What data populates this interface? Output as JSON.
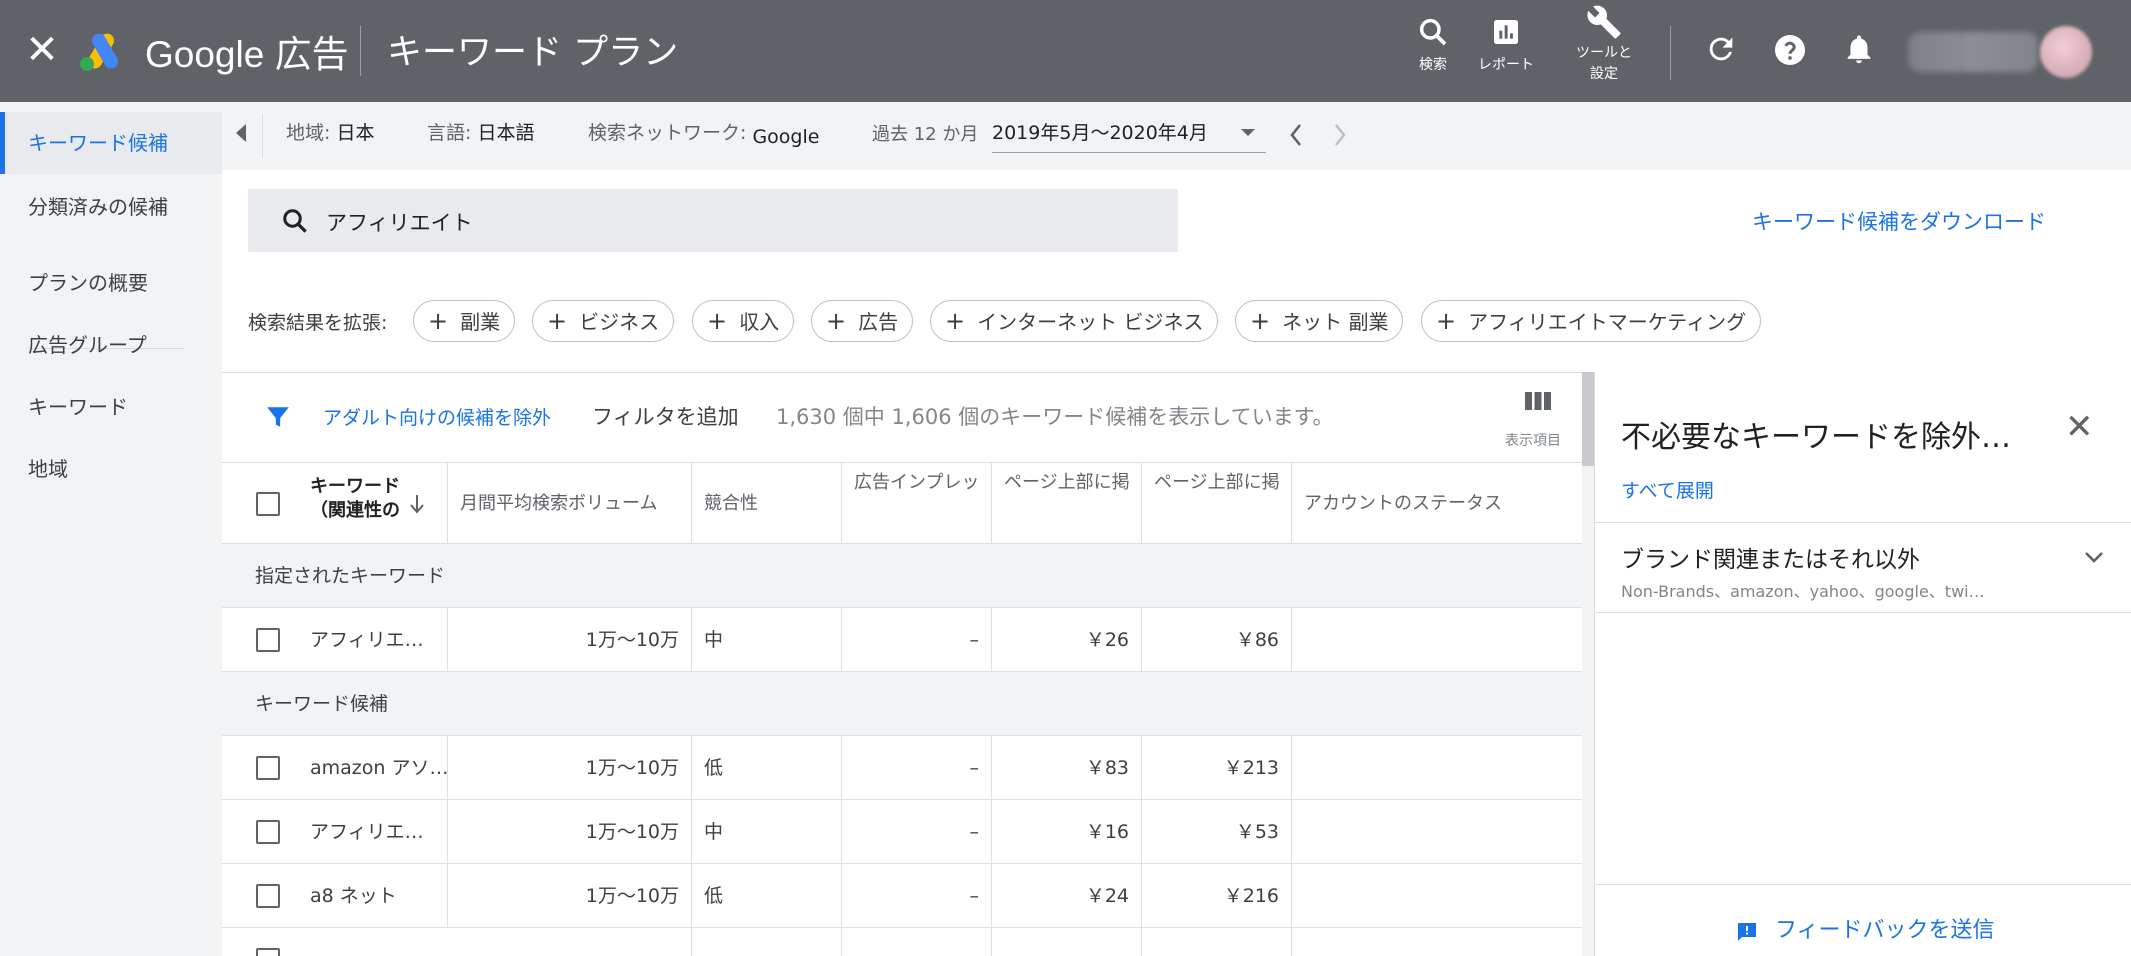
{
  "topbar": {
    "brand": "Google 広告",
    "page_title": "キーワード プラン",
    "search_label": "検索",
    "report_label": "レポート",
    "tools_label_1": "ツールと",
    "tools_label_2": "設定"
  },
  "criteria": {
    "location_label": "地域:",
    "location_value": "日本",
    "language_label": "言語:",
    "language_value": "日本語",
    "network_label": "検索ネットワーク:",
    "network_value": "Google",
    "period_label": "過去 12 か月",
    "period_value": "2019年5月～2020年4月"
  },
  "sidebar": {
    "items": [
      {
        "label": "キーワード候補"
      },
      {
        "label": "分類済みの候補"
      },
      {
        "label": "プランの概要"
      },
      {
        "label": "広告グループ"
      },
      {
        "label": "キーワード"
      },
      {
        "label": "地域"
      }
    ]
  },
  "search": {
    "query": "アフィリエイト",
    "download_label": "キーワード候補をダウンロード"
  },
  "broaden": {
    "label": "検索結果を拡張:",
    "chips": [
      "副業",
      "ビジネス",
      "収入",
      "広告",
      "インターネット ビジネス",
      "ネット 副業",
      "アフィリエイトマーケティング"
    ]
  },
  "filter": {
    "adult_link": "アダルト向けの候補を除外",
    "add_filter": "フィルタを追加",
    "count_text": "1,630 個中 1,606 個のキーワード候補を表示しています。",
    "columns_label": "表示項目"
  },
  "table": {
    "headers": {
      "keyword_1": "キーワード",
      "keyword_2": "（関連性の",
      "volume": "月間平均検索ボリューム",
      "competition": "競合性",
      "impression_share": "広告インプレッ",
      "bid_low": "ページ上部に掲",
      "bid_high": "ページ上部に掲",
      "status": "アカウントのステータス"
    },
    "group_provided": "指定されたキーワード",
    "group_ideas": "キーワード候補",
    "provided_rows": [
      {
        "keyword": "アフィリエ…",
        "volume": "1万～10万",
        "competition": "中",
        "impression": "–",
        "low": "￥26",
        "high": "￥86"
      }
    ],
    "idea_rows": [
      {
        "keyword": "amazon アソ…",
        "volume": "1万～10万",
        "competition": "低",
        "impression": "–",
        "low": "￥83",
        "high": "￥213"
      },
      {
        "keyword": "アフィリエ…",
        "volume": "1万～10万",
        "competition": "中",
        "impression": "–",
        "low": "￥16",
        "high": "￥53"
      },
      {
        "keyword": "a8 ネット",
        "volume": "1万～10万",
        "competition": "低",
        "impression": "–",
        "low": "￥24",
        "high": "￥216"
      }
    ]
  },
  "right_panel": {
    "title": "不必要なキーワードを除外…",
    "expand_all": "すべて展開",
    "section_title": "ブランド関連またはそれ以外",
    "section_sub": "Non-Brands、amazon、yahoo、google、twi…",
    "feedback": "フィードバックを送信"
  },
  "colors": {
    "topbar": "#5f6368",
    "accent": "#1a73e8",
    "nav_bg": "#f1f3f4"
  }
}
